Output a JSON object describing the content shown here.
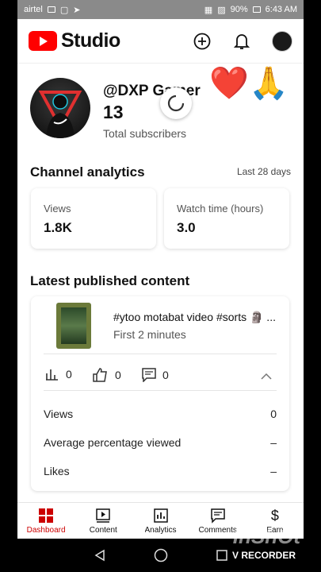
{
  "status_bar": {
    "carrier": "airtel",
    "battery": "90%",
    "time": "6:43 AM"
  },
  "header": {
    "brand": "Studio",
    "icons": [
      "create-icon",
      "bell-icon",
      "account-avatar"
    ]
  },
  "channel": {
    "handle": "@DXP Gamer",
    "subscribers": "13",
    "subscribers_label": "Total subscribers"
  },
  "overlay": {
    "emojis": [
      "❤️",
      "🙏"
    ]
  },
  "analytics": {
    "title": "Channel analytics",
    "period": "Last 28 days",
    "cards": [
      {
        "label": "Views",
        "value": "1.8K"
      },
      {
        "label": "Watch time (hours)",
        "value": "3.0"
      }
    ]
  },
  "latest": {
    "title": "Latest published content",
    "video_title": "#ytoo motabat video #sorts 🗿 ...",
    "video_sub": "First 2 minutes",
    "stats": {
      "views": "0",
      "likes": "0",
      "comments": "0"
    },
    "metrics": [
      {
        "label": "Views",
        "value": "0"
      },
      {
        "label": "Average percentage viewed",
        "value": "–"
      },
      {
        "label": "Likes",
        "value": "–"
      }
    ]
  },
  "bottom_nav": [
    {
      "label": "Dashboard",
      "active": true
    },
    {
      "label": "Content"
    },
    {
      "label": "Analytics"
    },
    {
      "label": "Comments"
    },
    {
      "label": "Earn"
    }
  ],
  "watermark": {
    "recorder": "V RECORDER",
    "app": "InShOt"
  },
  "colors": {
    "accent": "#cc0000",
    "brand_red": "#ff0000"
  }
}
